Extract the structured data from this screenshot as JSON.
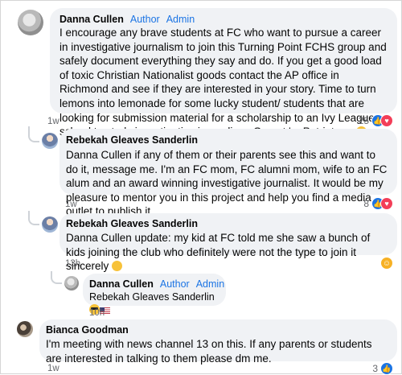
{
  "comments": [
    {
      "name": "Danna Cullen",
      "badges": [
        "Author",
        "Admin"
      ],
      "text": "I encourage any brave students at FC who want to pursue a career in investigative journalism to join this Turning Point FCHS group and safely document everything they say and do. If you get a good load of toxic Christian Nationalist goods contact the AP office in Richmond and see if they are interested in your story. Time to turn lemons into lemonade for some lucky student/ students that are looking for submission material for a scholarship to an Ivy League school to study investigative journalism. Go get 'm Patriots.",
      "emoji": [
        "us-flag",
        "smiling-face-with-sunglasses"
      ],
      "time": "1w",
      "reaction_count": "25",
      "reaction_icons": [
        "like-icon",
        "love-icon"
      ]
    },
    {
      "name": "Rebekah Gleaves Sanderlin",
      "text": "Danna Cullen if any of them or their parents see this and want to do it, message me. I'm an FC mom, FC alumni mom, wife to an FC alum and an award winning investigative journalist. It would be my pleasure to mentor you in this project and help you find a media outlet to publish it.",
      "time": "1w",
      "reaction_count": "8",
      "reaction_icons": [
        "like-icon",
        "love-icon"
      ]
    },
    {
      "name": "Rebekah Gleaves Sanderlin",
      "text": "Danna Cullen update: my kid at FC told me she saw a bunch of kids joining the club who definitely were not the type to join it sincerely",
      "emoji": [
        "rolling-on-floor-laughing"
      ],
      "time": "13h",
      "reaction_icons": [
        "haha-icon"
      ]
    },
    {
      "name": "Danna Cullen",
      "badges": [
        "Author",
        "Admin"
      ],
      "text": "Rebekah Gleaves Sanderlin",
      "emoji": [
        "smiling-face-with-sunglasses",
        "us-flag"
      ],
      "time": "10h"
    },
    {
      "name": "Bianca Goodman",
      "text": "I'm meeting with news channel 13 on this. If any parents or students are interested in talking to them please dm me.",
      "time": "1w",
      "reaction_count": "3",
      "reaction_icons": [
        "like-icon"
      ]
    }
  ],
  "colors": {
    "badge": "#1b74e4",
    "bubble": "#f0f2f5",
    "meta": "#65676b"
  }
}
